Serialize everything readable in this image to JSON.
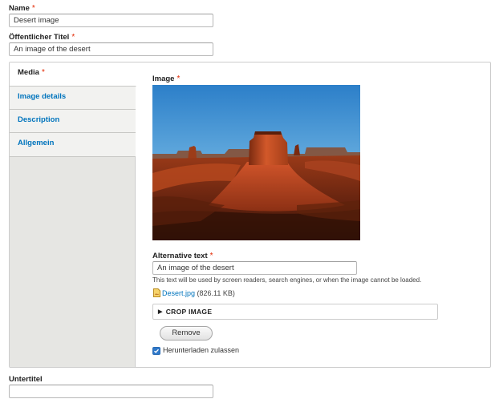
{
  "name_field": {
    "label": "Name",
    "required_mark": "*",
    "value": "Desert image"
  },
  "public_title_field": {
    "label": "Öffentlicher Titel",
    "required_mark": "*",
    "value": "An image of the desert"
  },
  "vertical_tabs": [
    {
      "label": "Media",
      "required_mark": "*",
      "active": true
    },
    {
      "label": "Image details",
      "active": false
    },
    {
      "label": "Description",
      "active": false
    },
    {
      "label": "Allgemein",
      "active": false
    }
  ],
  "media_pane": {
    "image_label": "Image",
    "image_required_mark": "*",
    "alt_label": "Alternative text",
    "alt_required_mark": "*",
    "alt_value": "An image of the desert",
    "alt_description": "This text will be used by screen readers, search engines, or when the image cannot be loaded.",
    "file_name": "Desert.jpg",
    "file_size": "(826.11 KB)",
    "file_icon": "image-file-icon",
    "crop_summary": "CROP IMAGE",
    "crop_toggle_icon": "triangle-right-icon",
    "remove_button": "Remove",
    "allow_download_label": "Herunterladen zulassen",
    "allow_download_checked": true
  },
  "subtitle_field": {
    "label": "Untertitel",
    "value": ""
  },
  "colors": {
    "link": "#0074bd",
    "required": "#e32700",
    "tab_menu_bg": "#e6e6e3",
    "checkbox": "#2f78c9"
  }
}
